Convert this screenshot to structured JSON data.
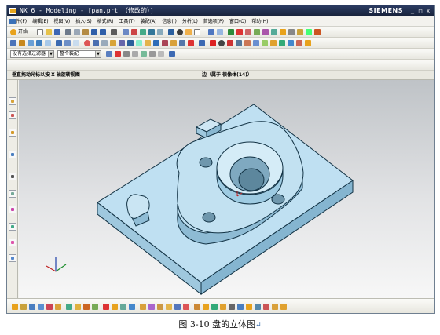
{
  "window": {
    "title": "NX 6 - Modeling - [pan.prt （修改的）]",
    "brand": "SIEMENS",
    "controls": [
      "_",
      "□",
      "x"
    ]
  },
  "menu": [
    "文件(F)",
    "编辑(E)",
    "视图(V)",
    "插入(S)",
    "格式(R)",
    "工具(T)",
    "装配(A)",
    "信息(I)",
    "分析(L)",
    "首选项(P)",
    "窗口(O)",
    "帮助(H)"
  ],
  "toolbar": {
    "start_label": "开始"
  },
  "selection": {
    "type_filter": "没有选择过滤器",
    "scope": "整个装配"
  },
  "cue_line": "垂直拖动光标以按 X 轴旋转视图",
  "status_line": "边（属于 很像体(14)）",
  "caption": {
    "text": "图 3-10  盘的立体图",
    "return_mark": "↵"
  },
  "colors": {
    "title_bar": "#1d2a48",
    "part_body": "#b9dcf0",
    "part_edge": "#123244",
    "viewport_top": "#bfc3c7",
    "viewport_bottom": "#f7f7f7"
  },
  "icons": {
    "triad": "wcs-triad-icon",
    "origin": "datum-csys-icon"
  }
}
